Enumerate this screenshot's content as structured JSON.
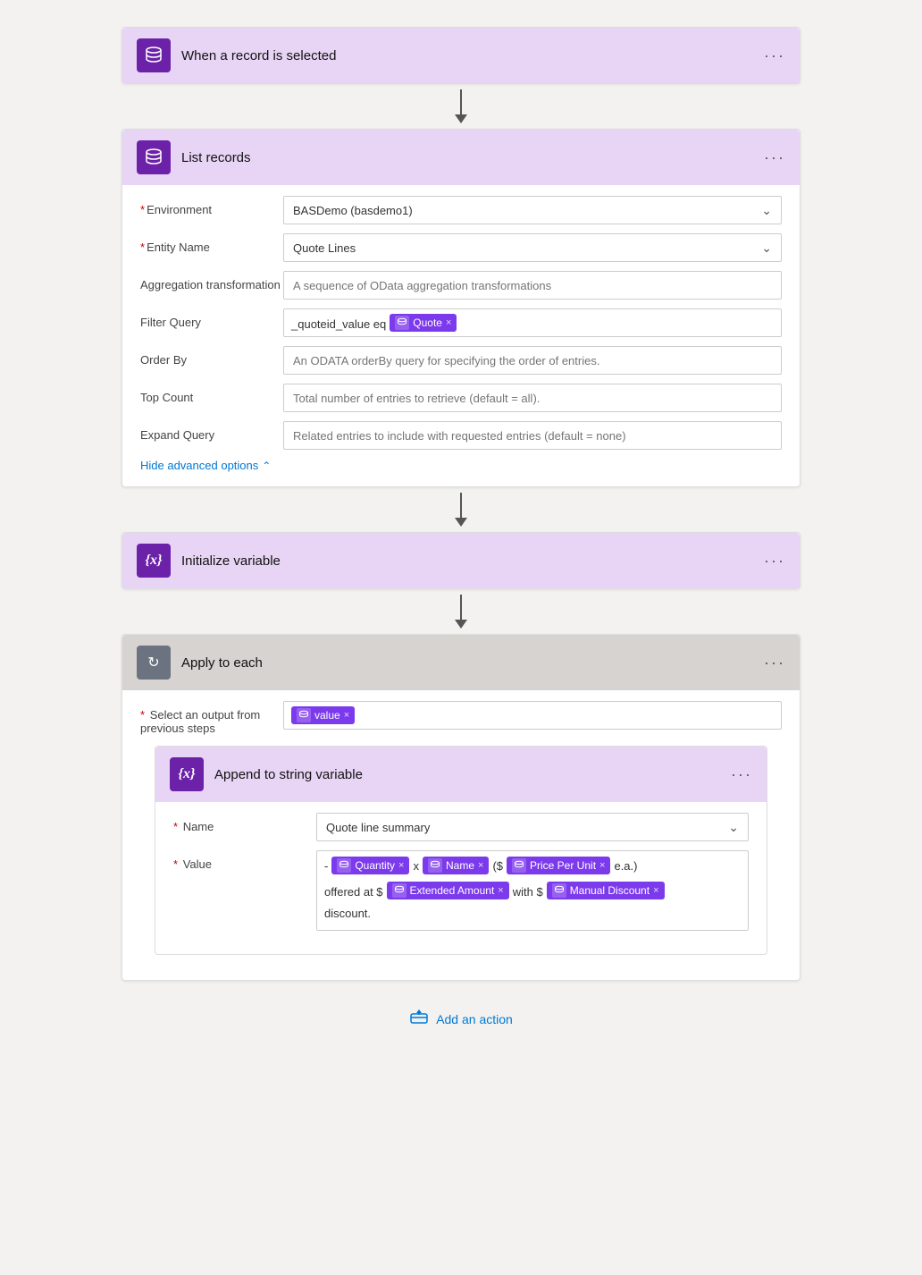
{
  "trigger": {
    "title": "When a record is selected",
    "menu_label": "···"
  },
  "list_records": {
    "title": "List records",
    "menu_label": "···",
    "fields": {
      "environment_label": "Environment",
      "environment_value": "BASDemo (basdemo1)",
      "entity_name_label": "Entity Name",
      "entity_name_value": "Quote Lines",
      "aggregation_label": "Aggregation transformation",
      "aggregation_placeholder": "A sequence of OData aggregation transformations",
      "filter_query_label": "Filter Query",
      "filter_query_prefix": "_quoteid_value eq",
      "filter_query_token": "Quote",
      "order_by_label": "Order By",
      "order_by_placeholder": "An ODATA orderBy query for specifying the order of entries.",
      "top_count_label": "Top Count",
      "top_count_placeholder": "Total number of entries to retrieve (default = all).",
      "expand_query_label": "Expand Query",
      "expand_query_placeholder": "Related entries to include with requested entries (default = none)",
      "hide_advanced_label": "Hide advanced options"
    }
  },
  "initialize_variable": {
    "title": "Initialize variable",
    "menu_label": "···"
  },
  "apply_to_each": {
    "title": "Apply to each",
    "menu_label": "···",
    "select_label": "Select an output from previous steps",
    "select_token": "value",
    "append_variable": {
      "title": "Append to string variable",
      "menu_label": "···",
      "name_label": "Name",
      "name_value": "Quote line summary",
      "value_label": "Value",
      "value_parts": {
        "dash": "-",
        "quantity_token": "Quantity",
        "x1": "x",
        "name_token": "Name",
        "paren_open": "($",
        "price_token": "Price Per Unit",
        "suffix1": "e.a.)",
        "offered_at": "offered at $",
        "extended_token": "Extended Amount",
        "with": "with $",
        "discount_token": "Manual Discount",
        "discount_suffix": "discount."
      }
    }
  },
  "add_action": {
    "label": "Add an action"
  },
  "colors": {
    "purple_dark": "#6b21a8",
    "purple_medium": "#7c3aed",
    "purple_light": "#e8d5f5",
    "gray_icon": "#6b7280",
    "blue_link": "#0078d4"
  }
}
